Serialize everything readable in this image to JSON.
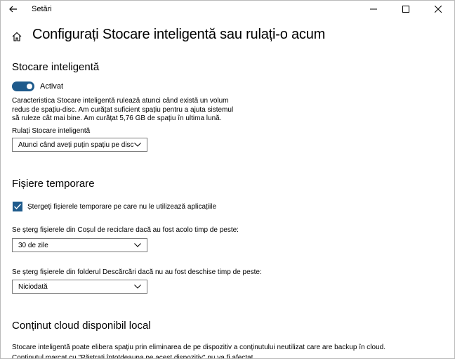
{
  "window": {
    "title": "Setări",
    "back_icon": "back-arrow-icon",
    "minimize_icon": "minimize-icon",
    "maximize_icon": "maximize-icon",
    "close_icon": "close-icon"
  },
  "page": {
    "home_icon": "home-icon",
    "title": "Configurați Stocare inteligentă sau rulați-o acum"
  },
  "storage_sense": {
    "heading": "Stocare inteligentă",
    "toggle_state": "on",
    "toggle_label": "Activat",
    "description": "Caracteristica Stocare inteligentă rulează atunci când există un volum redus de spațiu-disc. Am curățat suficient spațiu pentru a ajuta sistemul să ruleze cât mai bine. Am curățat 5,76 GB de spațiu în ultima lună.",
    "run_label": "Rulați Stocare inteligentă",
    "run_value": "Atunci când aveți puțin spațiu pe disc"
  },
  "temp_files": {
    "heading": "Fișiere temporare",
    "checkbox_checked": true,
    "checkbox_label": "Ștergeți fișierele temporare pe care nu le utilizează aplicațiile",
    "recycle_label": "Se șterg fișierele din Coșul de reciclare dacă au fost acolo timp de peste:",
    "recycle_value": "30 de zile",
    "downloads_label": "Se șterg fișierele din folderul Descărcări dacă nu au fost deschise timp de peste:",
    "downloads_value": "Niciodată"
  },
  "cloud": {
    "heading": "Conținut cloud disponibil local",
    "description": "Stocare inteligentă poate elibera spațiu prin eliminarea de pe dispozitiv a conținutului neutilizat care are backup în cloud.",
    "description2": "Conținutul marcat cu \"Păstrați întotdeauna pe acest dispozitiv\" nu va fi afectat."
  },
  "colors": {
    "accent": "#1f5b8c",
    "border": "#7a7a7a"
  }
}
